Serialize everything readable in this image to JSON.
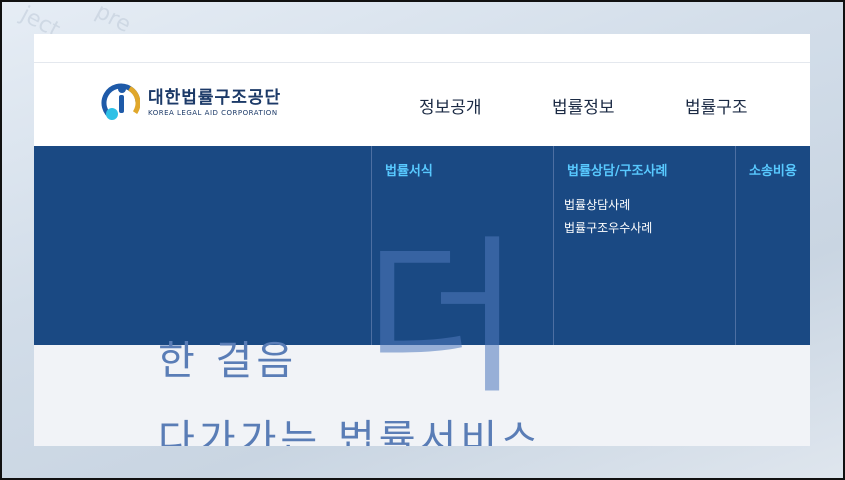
{
  "logo": {
    "name_ko": "대한법률구조공단",
    "name_en": "KOREA LEGAL AID CORPORATION"
  },
  "nav": [
    "정보공개",
    "법률정보",
    "법률구조"
  ],
  "dropdown": {
    "columns": [
      {
        "title": "법률서식",
        "items": []
      },
      {
        "title": "법률상담/구조사례",
        "items": [
          "법률상담사례",
          "법률구조우수사례"
        ]
      },
      {
        "title": "소송비용",
        "items": []
      }
    ]
  },
  "hero": {
    "line1": "한 걸음",
    "big_char": "더",
    "line2": "다가가는 법률서비스"
  },
  "colors": {
    "dropdown_bg": "#1a4983",
    "column_title": "#58c9ff",
    "hero_text": "#5a7db6"
  }
}
